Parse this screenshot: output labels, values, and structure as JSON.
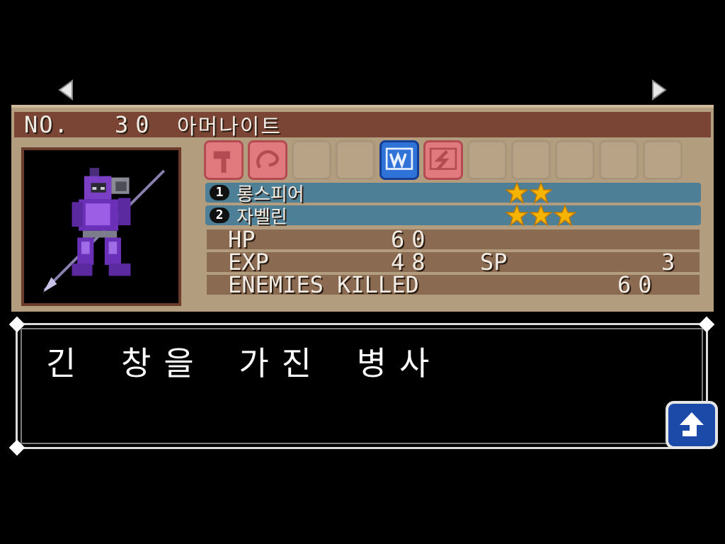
{
  "enemy": {
    "no_label": "NO.",
    "number": "30",
    "name": "아머나이트",
    "description": "긴 창을 가진 병사"
  },
  "resistances": [
    {
      "icon": "hammer-icon",
      "style": "red"
    },
    {
      "icon": "whip-icon",
      "style": "red"
    },
    {
      "icon": "empty",
      "style": "empty"
    },
    {
      "icon": "empty",
      "style": "empty"
    },
    {
      "icon": "water-icon",
      "style": "blue"
    },
    {
      "icon": "lightning-icon",
      "style": "red"
    },
    {
      "icon": "empty",
      "style": "empty"
    },
    {
      "icon": "empty",
      "style": "empty"
    },
    {
      "icon": "empty",
      "style": "empty"
    },
    {
      "icon": "empty",
      "style": "empty"
    },
    {
      "icon": "empty",
      "style": "empty"
    }
  ],
  "weapons": [
    {
      "num": "1",
      "name": "롱스피어",
      "stars": 2
    },
    {
      "num": "2",
      "name": "자벨린",
      "stars": 3
    }
  ],
  "stats": {
    "hp_label": "HP",
    "hp_value": "60",
    "exp_label": "EXP",
    "exp_value": "48",
    "sp_label": "SP",
    "sp_value": "3",
    "enemies_killed_label": "ENEMIES KILLED",
    "enemies_killed_value": "60"
  },
  "colors": {
    "panel": "#b29d7e",
    "title_bar": "#7a4535",
    "weapon_row": "#4d7f96",
    "stat_row": "#8a6a50",
    "star": "#f4b400"
  }
}
